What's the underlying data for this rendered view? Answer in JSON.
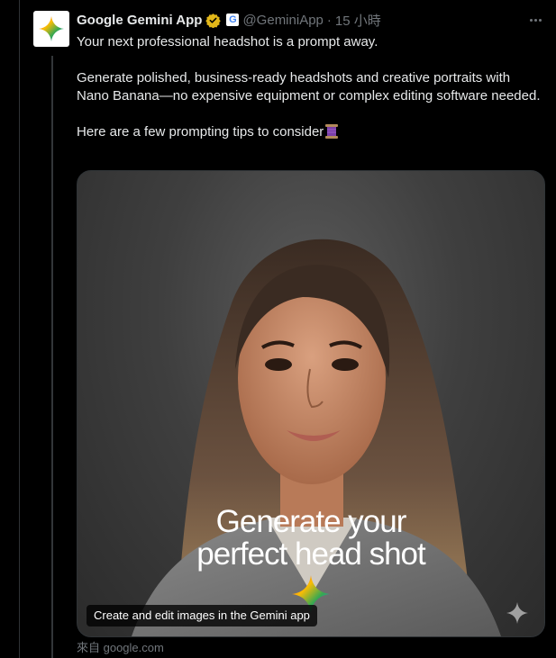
{
  "tweet": {
    "author_name": "Google Gemini App",
    "affiliation_letter": "G",
    "handle": "@GeminiApp",
    "separator": "·",
    "time": "15 小時",
    "paragraphs": [
      "Your next professional headshot is a prompt away.",
      "Generate polished, business-ready headshots and creative portraits with Nano Banana—no expensive equipment or complex editing software needed.",
      "Here are a few prompting tips to consider"
    ],
    "emoji_icon": "thread-spool-icon",
    "more_icon": "more-options-icon"
  },
  "card": {
    "headline_line1": "Generate your",
    "headline_line2": "perfect head shot",
    "caption": "Create and edit images in the Gemini app",
    "source": "來自 google.com"
  },
  "colors": {
    "background": "#000000",
    "primary_text": "#e7e9ea",
    "secondary_text": "#71767b",
    "divider": "#2f3336",
    "verified_gold": "#e2b719"
  }
}
